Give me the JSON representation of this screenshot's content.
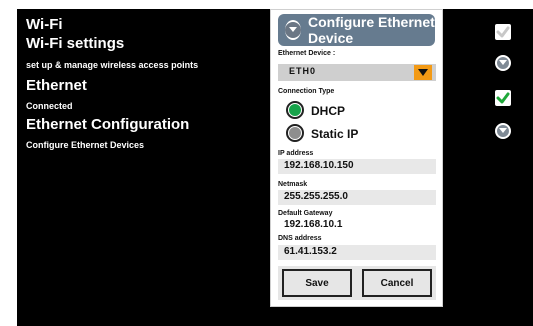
{
  "left": {
    "wifi_title": "Wi-Fi",
    "wifi_settings": "Wi-Fi settings",
    "wifi_desc": "set up & manage wireless access points",
    "ethernet_title": "Ethernet",
    "ethernet_status": "Connected",
    "eth_config_title": "Ethernet Configuration",
    "eth_config_desc": "Configure Ethernet Devices"
  },
  "right": {
    "wifi_checkbox": {
      "checked": true,
      "color": "#c8c8c8"
    },
    "ethernet_checkbox": {
      "checked": true,
      "color": "#1fa83a"
    }
  },
  "dialog": {
    "title": "Configure Ethernet Device",
    "device_label": "Ethernet Device :",
    "device_value": "ETH0",
    "connection_type_label": "Connection Type",
    "options": [
      {
        "label": "DHCP",
        "selected": true
      },
      {
        "label": "Static IP",
        "selected": false
      }
    ],
    "ip_label": "IP address",
    "ip_value": "192.168.10.150",
    "netmask_label": "Netmask",
    "netmask_value": "255.255.255.0",
    "gateway_label": "Default Gateway",
    "gateway_value": "192.168.10.1",
    "dns_label": "DNS address",
    "dns_value": "61.41.153.2",
    "save_label": "Save",
    "cancel_label": "Cancel"
  },
  "colors": {
    "accent_orange": "#f39a15",
    "selected_green": "#17a34a",
    "header_blue": "#667b8f"
  }
}
